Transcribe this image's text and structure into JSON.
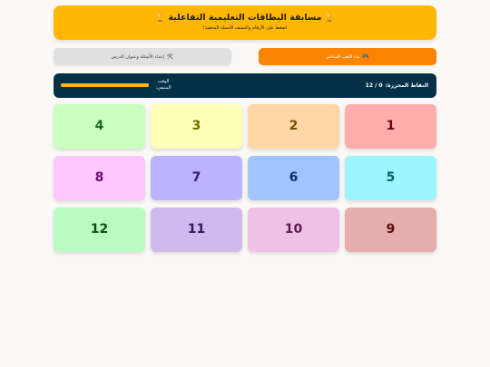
{
  "header": {
    "title": "مسابقة البطاقات التعليمية التفاعلية",
    "subtitle": "اضغط على الأرقام واكتشف الأسئلة المخفية!",
    "trophy_icon": "trophy-icon",
    "color": "#ffb703"
  },
  "toolbar": {
    "play_label": "بدء اللعب المباشر",
    "play_icon": "gamepad-icon",
    "setup_label": "إعداد الأسئلة وعنوان الدرس",
    "setup_icon": "tools-icon",
    "play_color": "#fb8500",
    "setup_color": "#e0e0e0"
  },
  "status": {
    "score_label": "النقاط المحرزة:",
    "score_value": "0 / 12",
    "time_label": "الوقت المتبقي:",
    "time_remaining_fraction": 1.0,
    "bar_color": "#ffb703",
    "panel_color": "#023047"
  },
  "cards": [
    {
      "number": "1",
      "bg": "#ffadad",
      "fg": "#6a040f"
    },
    {
      "number": "2",
      "bg": "#ffd6a5",
      "fg": "#7a4a00"
    },
    {
      "number": "3",
      "bg": "#fdffb6",
      "fg": "#6b6b00"
    },
    {
      "number": "4",
      "bg": "#caffbf",
      "fg": "#1b6b1b"
    },
    {
      "number": "5",
      "bg": "#9bf6ff",
      "fg": "#035e6b"
    },
    {
      "number": "6",
      "bg": "#a0c4ff",
      "fg": "#0b2e6b"
    },
    {
      "number": "7",
      "bg": "#bdb2ff",
      "fg": "#2f1b6b"
    },
    {
      "number": "8",
      "bg": "#ffc6ff",
      "fg": "#6b0b6b"
    },
    {
      "number": "9",
      "bg": "#e6adad",
      "fg": "#5a0b0b"
    },
    {
      "number": "10",
      "bg": "#f1c0e8",
      "fg": "#5a1b4f"
    },
    {
      "number": "11",
      "bg": "#cfbaf0",
      "fg": "#2f1b5a"
    },
    {
      "number": "12",
      "bg": "#b9fbc0",
      "fg": "#0f4d1b"
    }
  ]
}
